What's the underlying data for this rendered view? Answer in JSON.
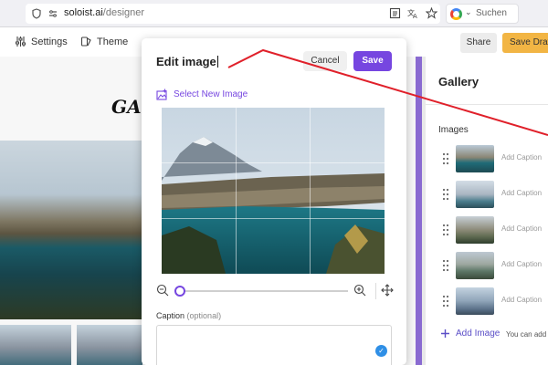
{
  "browser": {
    "url_host": "soloist.ai",
    "url_path": "/designer",
    "search_placeholder": "Suchen"
  },
  "toolbar": {
    "settings_label": "Settings",
    "theme_label": "Theme",
    "share_label": "Share",
    "save_draft_label": "Save Draft"
  },
  "canvas": {
    "logo_text": "GA"
  },
  "gallery": {
    "title": "Gallery",
    "section_label": "Images",
    "images": [
      {
        "caption_placeholder": "Add Caption"
      },
      {
        "caption_placeholder": "Add Caption"
      },
      {
        "caption_placeholder": "Add Caption"
      },
      {
        "caption_placeholder": "Add Caption"
      },
      {
        "caption_placeholder": "Add Caption"
      }
    ],
    "add_image_label": "Add Image",
    "add_hint": "You can add"
  },
  "modal": {
    "title": "Edit image",
    "cancel_label": "Cancel",
    "save_label": "Save",
    "select_new_label": "Select New Image",
    "zoom_level": 0,
    "caption_label": "Caption",
    "caption_optional": "(optional)",
    "caption_value": ""
  },
  "colors": {
    "accent": "#7646e0",
    "save_draft": "#f2b544",
    "annotation": "#e0202a"
  },
  "icons": [
    "shield-icon",
    "settings-icon",
    "theme-icon",
    "reader-icon",
    "translate-icon",
    "star-icon",
    "image-add-icon",
    "zoom-out-icon",
    "zoom-in-icon",
    "move-icon",
    "drag-handle-icon",
    "plus-icon",
    "check-icon"
  ]
}
